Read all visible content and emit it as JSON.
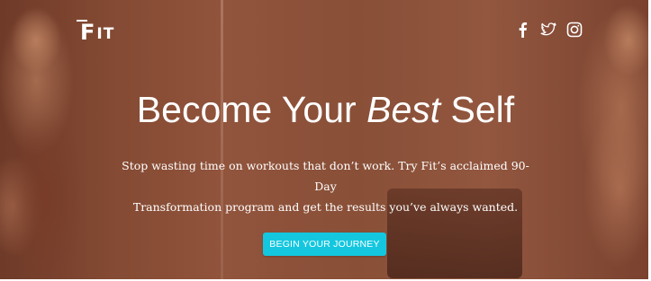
{
  "brand": {
    "logo_first": "F",
    "logo_rest": "IT"
  },
  "social": [
    {
      "icon": "facebook-icon",
      "glyph": "f"
    },
    {
      "icon": "twitter-icon",
      "glyph": "twitter"
    },
    {
      "icon": "instagram-icon",
      "glyph": "instagram"
    }
  ],
  "hero": {
    "headline_start": "Become Your ",
    "headline_emphasis": "Best",
    "headline_end": " Self",
    "subtext_line1": "Stop wasting time on workouts that don’t work. Try Fit’s acclaimed 90-Day",
    "subtext_line2": "Transformation program and get the results you’ve always wanted.",
    "cta_label": "BEGIN YOUR JOURNEY"
  },
  "colors": {
    "accent": "#14c7df",
    "overlay": "#8a5038",
    "text": "#ffffff"
  }
}
